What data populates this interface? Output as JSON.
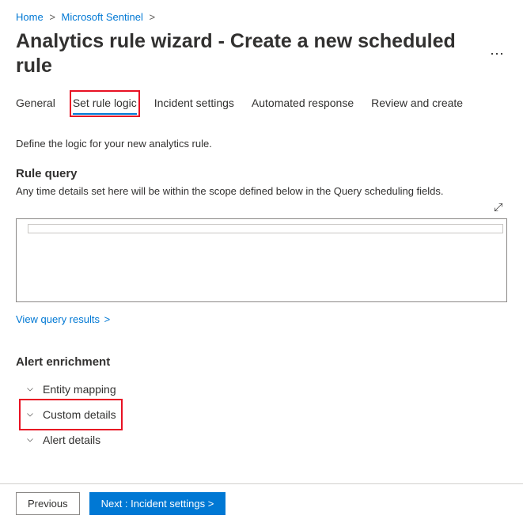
{
  "breadcrumb": {
    "home": "Home",
    "sentinel": "Microsoft Sentinel"
  },
  "title": "Analytics rule wizard - Create a new scheduled rule",
  "tabs": {
    "general": "General",
    "set_rule_logic": "Set rule logic",
    "incident_settings": "Incident settings",
    "automated_response": "Automated response",
    "review_create": "Review and create"
  },
  "intro": "Define the logic for your new analytics rule.",
  "rule_query": {
    "heading": "Rule query",
    "subtext": "Any time details set here will be within the scope defined below in the Query scheduling fields.",
    "value": "",
    "view_results": "View query results",
    "chevron": ">"
  },
  "enrichment": {
    "heading": "Alert enrichment",
    "items": [
      {
        "label": "Entity mapping"
      },
      {
        "label": "Custom details"
      },
      {
        "label": "Alert details"
      }
    ]
  },
  "footer": {
    "previous": "Previous",
    "next": "Next : Incident settings >"
  }
}
